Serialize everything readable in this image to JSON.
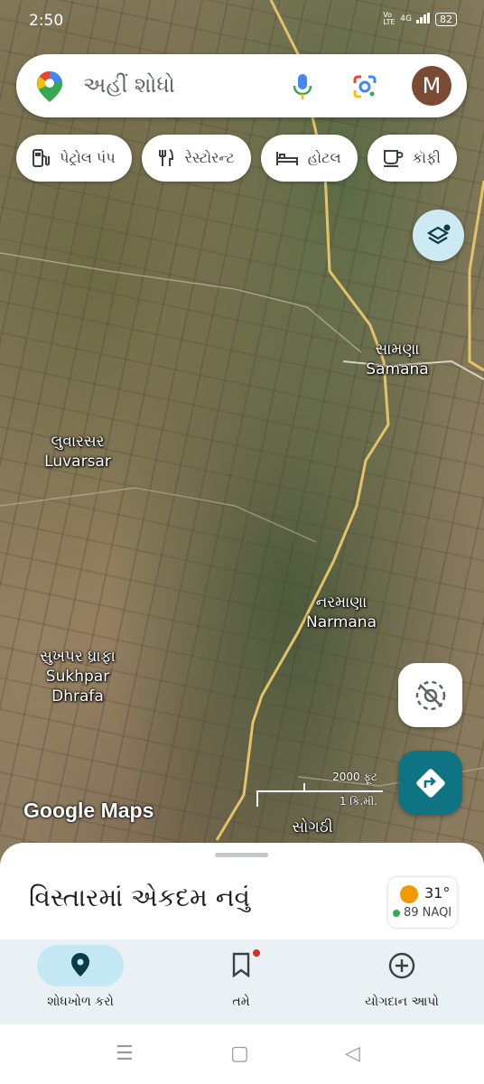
{
  "status_bar": {
    "time": "2:50",
    "network": "4G",
    "volte": "Vo LTE",
    "battery": "82"
  },
  "search": {
    "placeholder": "અહીં શોધો",
    "account_initial": "M"
  },
  "chips": [
    {
      "label": "પેટ્રોલ પંપ",
      "icon": "fuel-icon"
    },
    {
      "label": "રેસ્ટોરન્ટ",
      "icon": "restaurant-icon"
    },
    {
      "label": "હોટલ",
      "icon": "hotel-icon"
    },
    {
      "label": "કૉફી",
      "icon": "coffee-icon"
    }
  ],
  "map": {
    "places": [
      {
        "native": "સામણા",
        "english": "Samana"
      },
      {
        "native": "લુવારસર",
        "english": "Luvarsar"
      },
      {
        "native": "નરમાણા",
        "english": "Narmana"
      },
      {
        "native": "સુખપર ધ્રાફા",
        "english": "Sukhpar",
        "english2": "Dhrafa"
      },
      {
        "native": "સોગઠી"
      }
    ],
    "watermark": "Google Maps",
    "scale": {
      "top": "2000 ફૂટ",
      "bottom": "1 કિ.મી."
    }
  },
  "sheet": {
    "title": "વિસ્તારમાં એકદમ નવું",
    "weather": {
      "temp": "31°",
      "aqi": "89 NAQI"
    }
  },
  "bottom_nav": [
    {
      "label": "શોધખોળ કરો",
      "icon": "explore-pin-icon",
      "active": true
    },
    {
      "label": "તમે",
      "icon": "saved-bookmark-icon",
      "active": false
    },
    {
      "label": "યોગદાન આપો",
      "icon": "contribute-plus-icon",
      "active": false
    }
  ],
  "colors": {
    "accent": "#0e7484",
    "active_pill": "#c3e8f3",
    "road": "#e2c36a"
  }
}
